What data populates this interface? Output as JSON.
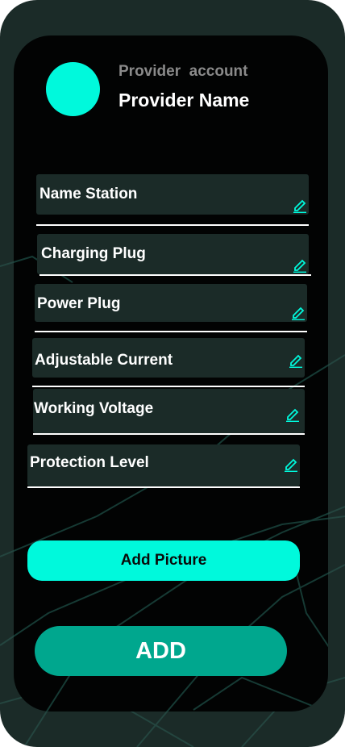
{
  "header": {
    "account_label": "Provider  account",
    "provider_name": "Provider Name"
  },
  "fields": [
    {
      "label": "Name Station",
      "icon": "edit-pencil-icon"
    },
    {
      "label": "Charging Plug",
      "icon": "edit-pencil-icon"
    },
    {
      "label": "Power Plug",
      "icon": "edit-pencil-icon"
    },
    {
      "label": "Adjustable Current",
      "icon": "edit-pencil-icon"
    },
    {
      "label": "Working Voltage",
      "icon": "edit-pencil-icon"
    },
    {
      "label": "Protection Level",
      "icon": "edit-pencil-icon"
    }
  ],
  "buttons": {
    "add_picture": "Add Picture",
    "add": "ADD"
  },
  "colors": {
    "accent": "#00f9dc",
    "button_primary": "#00a78e",
    "field_bg": "#1b2b28",
    "screen_bg": "#020303",
    "frame_bg": "#1b2b28"
  }
}
